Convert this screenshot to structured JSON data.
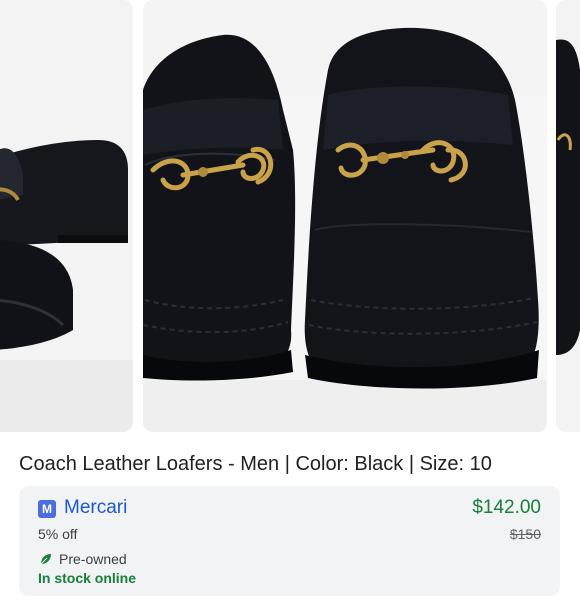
{
  "product": {
    "title": "Coach Leather Loafers - Men | Color: Black | Size: 10",
    "images": {
      "left": "black-loafer-side-photo",
      "main": "black-loafers-front-photo",
      "right": "next-photo-peek"
    }
  },
  "offer": {
    "merchant_logo_letter": "M",
    "merchant_name": "Mercari",
    "discount": "5% off",
    "price": "$142.00",
    "original_price": "$150",
    "condition_icon": "leaf-icon",
    "condition": "Pre-owned",
    "availability": "In stock online"
  },
  "colors": {
    "merchant_link": "#1a57d6",
    "price": "#188038",
    "merchant_logo": "#4a6ee0",
    "card_background": "#f1f3f4"
  }
}
